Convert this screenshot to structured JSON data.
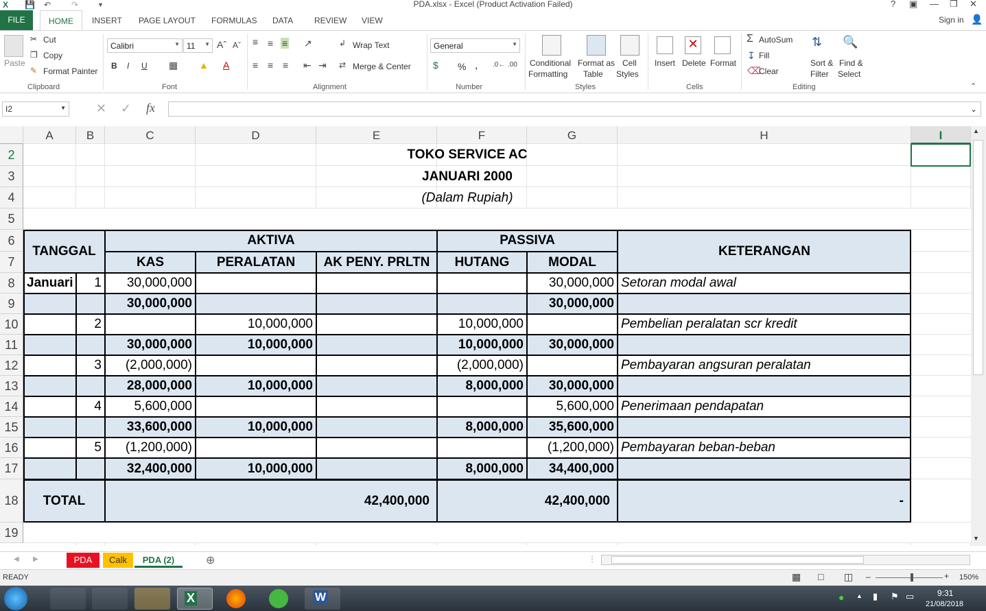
{
  "window": {
    "title": "PDA.xlsx - Excel (Product Activation Failed)",
    "help": "?",
    "sign_in": "Sign in"
  },
  "ribbon_tabs": [
    "FILE",
    "HOME",
    "INSERT",
    "PAGE LAYOUT",
    "FORMULAS",
    "DATA",
    "REVIEW",
    "VIEW"
  ],
  "clipboard": {
    "paste": "Paste",
    "cut": "Cut",
    "copy": "Copy",
    "format_painter": "Format Painter",
    "group": "Clipboard"
  },
  "font": {
    "name": "Calibri",
    "size": "11",
    "bold": "B",
    "italic": "I",
    "underline": "U",
    "group": "Font"
  },
  "alignment": {
    "wrap": "Wrap Text",
    "merge": "Merge & Center",
    "group": "Alignment"
  },
  "number": {
    "format": "General",
    "percent": "%",
    "comma": ",",
    "group": "Number"
  },
  "styles": {
    "conditional": "Conditional",
    "conditional2": "Formatting",
    "format_as": "Format as",
    "format_as2": "Table",
    "cell": "Cell",
    "cell2": "Styles",
    "group": "Styles"
  },
  "cells": {
    "insert": "Insert",
    "delete": "Delete",
    "format": "Format",
    "group": "Cells"
  },
  "editing": {
    "autosum": "AutoSum",
    "fill": "Fill",
    "clear": "Clear",
    "sort": "Sort &",
    "sort2": "Filter",
    "find": "Find &",
    "find2": "Select",
    "group": "Editing"
  },
  "formula_bar": {
    "name_box": "I2",
    "fx": "fx",
    "value": ""
  },
  "columns": [
    "A",
    "B",
    "C",
    "D",
    "E",
    "F",
    "G",
    "H",
    "I"
  ],
  "rows": [
    "2",
    "3",
    "4",
    "5",
    "6",
    "7",
    "8",
    "9",
    "10",
    "11",
    "12",
    "13",
    "14",
    "15",
    "16",
    "17",
    "18",
    "19"
  ],
  "sheet": {
    "title1": "TOKO SERVICE AC",
    "title2": "JANUARI 2000",
    "title3": "(Dalam Rupiah)",
    "h_tanggal": "TANGGAL",
    "h_aktiva": "AKTIVA",
    "h_passiva": "PASSIVA",
    "h_keterangan": "KETERANGAN",
    "h_kas": "KAS",
    "h_peralatan": "PERALATAN",
    "h_akpeny": "AK PENY. PRLTN",
    "h_hutang": "HUTANG",
    "h_modal": "MODAL",
    "month": "Januari",
    "total_label": "TOTAL",
    "total_aktiva": "42,400,000",
    "total_passiva": "42,400,000",
    "total_ket": "-",
    "entries": [
      {
        "day": "1",
        "kas": "30,000,000",
        "peralatan": "",
        "akpeny": "",
        "hutang": "",
        "modal": "30,000,000",
        "ket": "Setoran modal awal",
        "bold": false
      },
      {
        "day": "",
        "kas": "30,000,000",
        "peralatan": "",
        "akpeny": "",
        "hutang": "",
        "modal": "30,000,000",
        "ket": "",
        "bold": true
      },
      {
        "day": "2",
        "kas": "",
        "peralatan": "10,000,000",
        "akpeny": "",
        "hutang": "10,000,000",
        "modal": "",
        "ket": "Pembelian peralatan scr kredit",
        "bold": false
      },
      {
        "day": "",
        "kas": "30,000,000",
        "peralatan": "10,000,000",
        "akpeny": "",
        "hutang": "10,000,000",
        "modal": "30,000,000",
        "ket": "",
        "bold": true
      },
      {
        "day": "3",
        "kas": "(2,000,000)",
        "peralatan": "",
        "akpeny": "",
        "hutang": "(2,000,000)",
        "modal": "",
        "ket": "Pembayaran angsuran peralatan",
        "bold": false
      },
      {
        "day": "",
        "kas": "28,000,000",
        "peralatan": "10,000,000",
        "akpeny": "",
        "hutang": "8,000,000",
        "modal": "30,000,000",
        "ket": "",
        "bold": true
      },
      {
        "day": "4",
        "kas": "5,600,000",
        "peralatan": "",
        "akpeny": "",
        "hutang": "",
        "modal": "5,600,000",
        "ket": "Penerimaan pendapatan",
        "bold": false
      },
      {
        "day": "",
        "kas": "33,600,000",
        "peralatan": "10,000,000",
        "akpeny": "",
        "hutang": "8,000,000",
        "modal": "35,600,000",
        "ket": "",
        "bold": true
      },
      {
        "day": "5",
        "kas": "(1,200,000)",
        "peralatan": "",
        "akpeny": "",
        "hutang": "",
        "modal": "(1,200,000)",
        "ket": "Pembayaran beban-beban",
        "bold": false
      },
      {
        "day": "",
        "kas": "32,400,000",
        "peralatan": "10,000,000",
        "akpeny": "",
        "hutang": "8,000,000",
        "modal": "34,400,000",
        "ket": "",
        "bold": true
      }
    ]
  },
  "sheet_tabs": [
    {
      "label": "PDA",
      "color": "#e81123",
      "text": "#ffffff",
      "active": false
    },
    {
      "label": "Calk",
      "color": "#ffc000",
      "text": "#333333",
      "active": false
    },
    {
      "label": "PDA (2)",
      "color": "#ffffff",
      "text": "#217346",
      "active": true
    }
  ],
  "status": {
    "ready": "READY",
    "zoom": "150%"
  },
  "tray": {
    "time": "9:31",
    "date": "21/08/2018"
  },
  "colors": {
    "excel_green": "#217346",
    "band": "#dce6f1"
  }
}
